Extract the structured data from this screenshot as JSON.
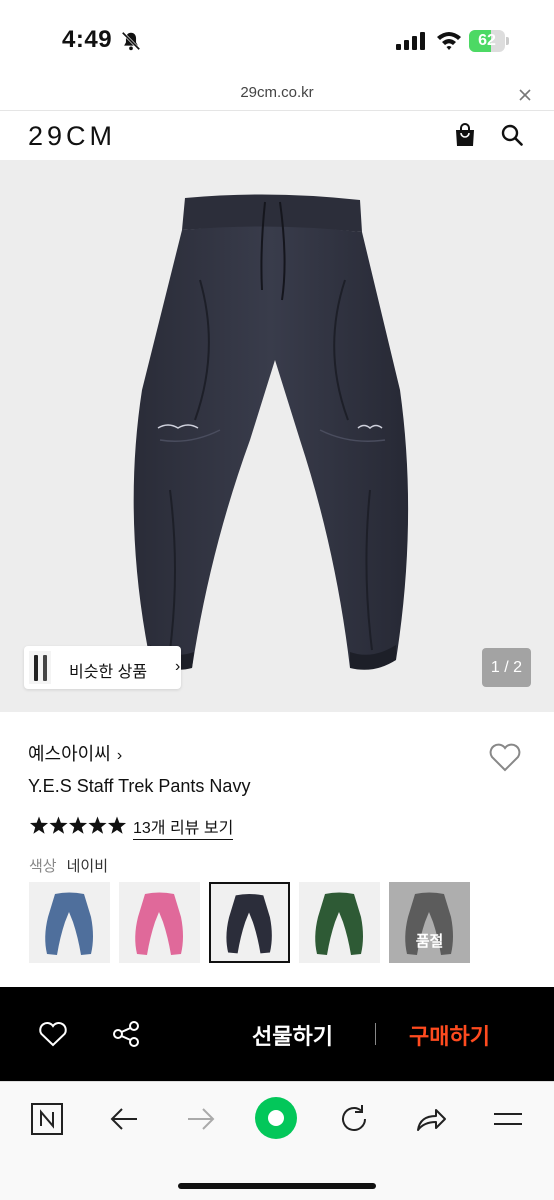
{
  "status_bar": {
    "time": "4:49",
    "battery_level": "62",
    "battery_fraction": 0.62,
    "icons": [
      "bell-muted-icon",
      "signal-icon",
      "wifi-icon",
      "battery-icon"
    ]
  },
  "browser": {
    "url": "29cm.co.kr",
    "toolbar_icons": [
      "naver-n-icon",
      "back-arrow-icon",
      "forward-arrow-icon",
      "green-home-icon",
      "reload-icon",
      "share-arrow-icon",
      "menu-icon"
    ]
  },
  "header": {
    "logo": "29CM",
    "icons": [
      "shopping-bag-icon",
      "search-icon"
    ]
  },
  "product": {
    "similar_label": "비슷한 상품",
    "similar_chevron": "›",
    "page_indicator": "1 / 2",
    "brand": "예스아이씨",
    "brand_chevron": "›",
    "name": "Y.E.S Staff Trek Pants Navy",
    "rating": 5,
    "review_link": "13개 리뷰 보기",
    "color_label": "색상",
    "color_value": "네이비",
    "swatches": [
      {
        "color": "#4f6f9c",
        "selected": false
      },
      {
        "color": "#e0699a",
        "selected": false
      },
      {
        "color": "#2b2d3a",
        "selected": true
      },
      {
        "color": "#2e5a35",
        "selected": false
      },
      {
        "color": "#3a3a3a",
        "selected": false,
        "sold_out": "품절"
      }
    ]
  },
  "purchase_bar": {
    "gift_label": "선물하기",
    "buy_label": "구매하기",
    "accent_color": "#ff4b1f"
  }
}
